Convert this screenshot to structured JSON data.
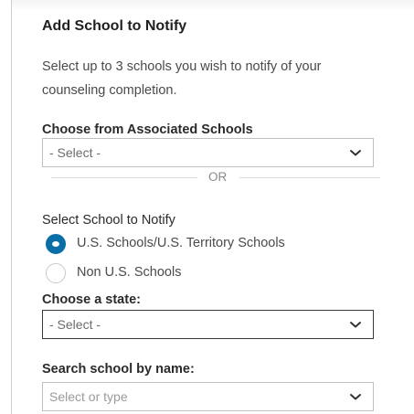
{
  "dialog": {
    "title": "Add School to Notify",
    "description": "Select up to 3 schools you wish to notify of your counseling completion."
  },
  "associated": {
    "label": "Choose from Associated Schools",
    "value": "- Select -"
  },
  "divider": {
    "text": "OR"
  },
  "notify": {
    "label": "Select School to Notify",
    "options": [
      {
        "label": "U.S. Schools/U.S. Territory Schools",
        "selected": true
      },
      {
        "label": "Non U.S. Schools",
        "selected": false
      }
    ]
  },
  "state": {
    "label": "Choose a state:",
    "value": "- Select -"
  },
  "search": {
    "label": "Search school by name:",
    "placeholder": "Select or type"
  },
  "colors": {
    "accent": "#0a6fa6",
    "border": "#bfbfbf",
    "focused_border": "#3a3a3a"
  },
  "icons": {
    "dropdown": "chevron-down-icon",
    "radio_selected": "radio-selected-icon",
    "radio_unselected": "radio-unselected-icon"
  }
}
